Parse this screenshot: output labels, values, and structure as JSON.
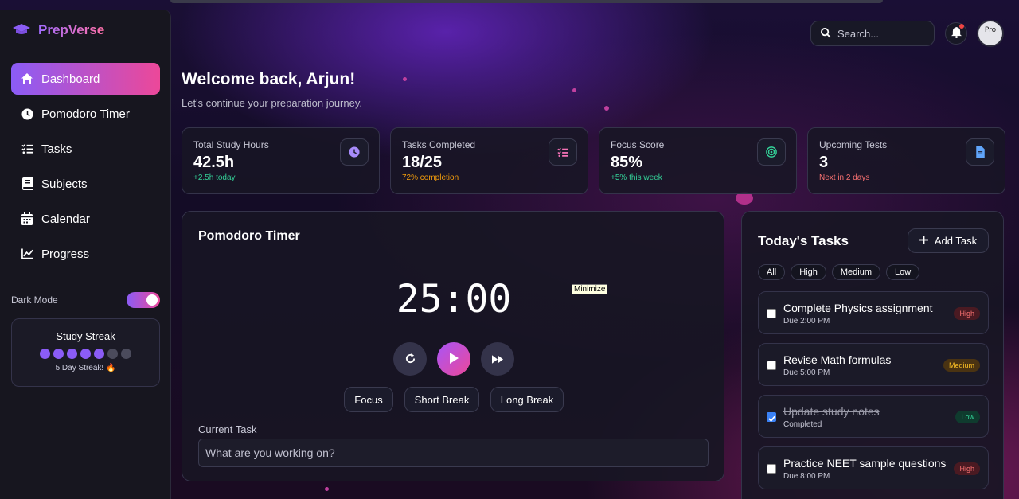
{
  "app": {
    "name": "PrepVerse"
  },
  "sidebar": {
    "items": [
      {
        "label": "Dashboard",
        "icon": "home-icon",
        "active": true
      },
      {
        "label": "Pomodoro Timer",
        "icon": "clock-icon"
      },
      {
        "label": "Tasks",
        "icon": "list-check-icon"
      },
      {
        "label": "Subjects",
        "icon": "book-icon"
      },
      {
        "label": "Calendar",
        "icon": "calendar-icon"
      },
      {
        "label": "Progress",
        "icon": "chart-line-icon"
      }
    ],
    "dark_mode_label": "Dark Mode",
    "dark_mode_on": true,
    "streak": {
      "title": "Study Streak",
      "days": 5,
      "total": 7,
      "subtitle": "5 Day Streak! 🔥"
    }
  },
  "header": {
    "search_placeholder": "Search...",
    "avatar_alt": "Pro"
  },
  "welcome": {
    "title": "Welcome back, Arjun!",
    "subtitle": "Let's continue your preparation journey."
  },
  "stats": [
    {
      "label": "Total Study Hours",
      "value": "42.5h",
      "note": "+2.5h today",
      "note_color": "#34d399",
      "icon": "clock-icon",
      "icon_color": "#a78bfa"
    },
    {
      "label": "Tasks Completed",
      "value": "18/25",
      "note": "72% completion",
      "note_color": "#f59e0b",
      "icon": "list-check-icon",
      "icon_color": "#f472b6"
    },
    {
      "label": "Focus Score",
      "value": "85%",
      "note": "+5% this week",
      "note_color": "#34d399",
      "icon": "target-icon",
      "icon_color": "#34d399"
    },
    {
      "label": "Upcoming Tests",
      "value": "3",
      "note": "Next in 2 days",
      "note_color": "#f87171",
      "icon": "document-icon",
      "icon_color": "#60a5fa"
    }
  ],
  "pomodoro": {
    "title": "Pomodoro Timer",
    "time": "25:00",
    "tooltip": "Minimize",
    "modes": [
      "Focus",
      "Short Break",
      "Long Break"
    ],
    "current_task_label": "Current Task",
    "current_task_placeholder": "What are you working on?"
  },
  "tasks": {
    "title": "Today's Tasks",
    "add_label": "Add Task",
    "filters": [
      "All",
      "High",
      "Medium",
      "Low"
    ],
    "items": [
      {
        "title": "Complete Physics assignment",
        "due": "Due 2:00 PM",
        "priority": "High",
        "done": false
      },
      {
        "title": "Revise Math formulas",
        "due": "Due 5:00 PM",
        "priority": "Medium",
        "done": false
      },
      {
        "title": "Update study notes",
        "due": "Completed",
        "priority": "Low",
        "done": true
      },
      {
        "title": "Practice NEET sample questions",
        "due": "Due 8:00 PM",
        "priority": "High",
        "done": false
      }
    ]
  }
}
